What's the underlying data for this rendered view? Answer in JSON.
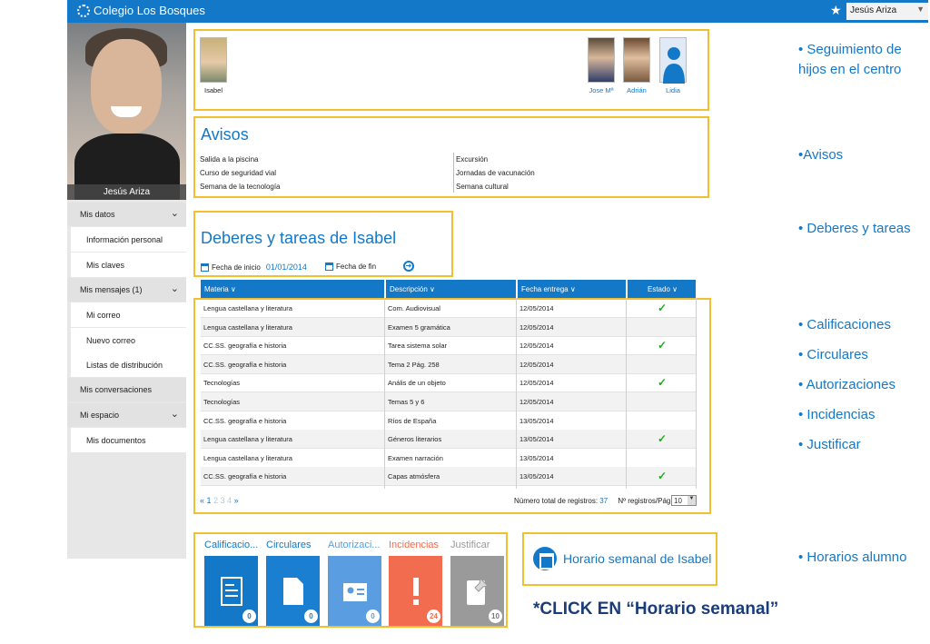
{
  "header": {
    "brand": "Colegio Los Bosques",
    "user": "Jesús Ariza"
  },
  "profile": {
    "name": "Jesús Ariza"
  },
  "sidebar": {
    "mis_datos": "Mis datos",
    "info_personal": "Información personal",
    "mis_claves": "Mis claves",
    "mis_mensajes": "Mis mensajes (1)",
    "mi_correo": "Mi correo",
    "nuevo_correo": "Nuevo correo",
    "listas": "Listas de distribución",
    "conversaciones": "Mis conversaciones",
    "mi_espacio": "Mi espacio",
    "documentos": "Mis documentos"
  },
  "children": [
    "Isabel",
    "Jose Mª",
    "Adrián",
    "Lidia"
  ],
  "avisos": {
    "title": "Avisos",
    "left": [
      "Salida a la piscina",
      "Curso de seguridad vial",
      "Semana de la tecnología"
    ],
    "right": [
      "Excursión",
      "Jornadas de vacunación",
      "Semana cultural"
    ]
  },
  "deberes": {
    "title": "Deberes y tareas de Isabel",
    "fecha_inicio_label": "Fecha de inicio",
    "fecha_inicio": "01/01/2014",
    "fecha_fin_label": "Fecha de fin"
  },
  "table": {
    "headers": [
      "Materia ∨",
      "Descripción ∨",
      "Fecha entrega ∨",
      "Estado ∨"
    ],
    "rows": [
      [
        "Lengua castellana y literatura",
        "Com. Audiovisual",
        "12/05/2014",
        "✓"
      ],
      [
        "Lengua castellana y literatura",
        "Examen 5 gramática",
        "12/05/2014",
        ""
      ],
      [
        "CC.SS. geografía e historia",
        "Tarea sistema solar",
        "12/05/2014",
        "✓"
      ],
      [
        "CC.SS. geografía e historia",
        "Tema 2 Pág. 258",
        "12/05/2014",
        ""
      ],
      [
        "Tecnologías",
        "Anális de un objeto",
        "12/05/2014",
        "✓"
      ],
      [
        "Tecnologías",
        "Temas 5 y 6",
        "12/05/2014",
        ""
      ],
      [
        "CC.SS. geografía e historia",
        "Ríos de España",
        "13/05/2014",
        ""
      ],
      [
        "Lengua castellana y literatura",
        "Géneros literarios",
        "13/05/2014",
        "✓"
      ],
      [
        "Lengua castellana y literatura",
        "Examen narración",
        "13/05/2014",
        ""
      ],
      [
        "CC.SS. geografía e historia",
        "Capas atmósfera",
        "13/05/2014",
        "✓"
      ]
    ],
    "pager": {
      "prev": "«",
      "p1": "1",
      "p2": "2",
      "p3": "3",
      "p4": "4",
      "next": "»"
    },
    "total_label": "Número total de registros:",
    "total": "37",
    "per_page_label": "Nº registros/Pág.",
    "per_page": "10"
  },
  "tiles": [
    {
      "label": "Calificacio...",
      "count": "0",
      "color": "#1478c8"
    },
    {
      "label": "Circulares",
      "count": "0",
      "color": "#1a7fd0"
    },
    {
      "label": "Autorizaci...",
      "count": "0",
      "color": "#5a9de0"
    },
    {
      "label": "Incidencias",
      "count": "24",
      "color": "#f26c4f"
    },
    {
      "label": "Justificar",
      "count": "10",
      "color": "#9a9a9a"
    }
  ],
  "horario": {
    "label": "Horario semanal de Isabel"
  },
  "click_note": "*CLICK EN “Horario  semanal”",
  "notes": {
    "n1": "• Seguimiento de hijos en el centro",
    "n2": "•Avisos",
    "n3": "• Deberes y tareas",
    "n4": "• Calificaciones",
    "n5": "• Circulares",
    "n6": "• Autorizaciones",
    "n7": "• Incidencias",
    "n8": "• Justificar",
    "n9": "• Horarios alumno"
  }
}
